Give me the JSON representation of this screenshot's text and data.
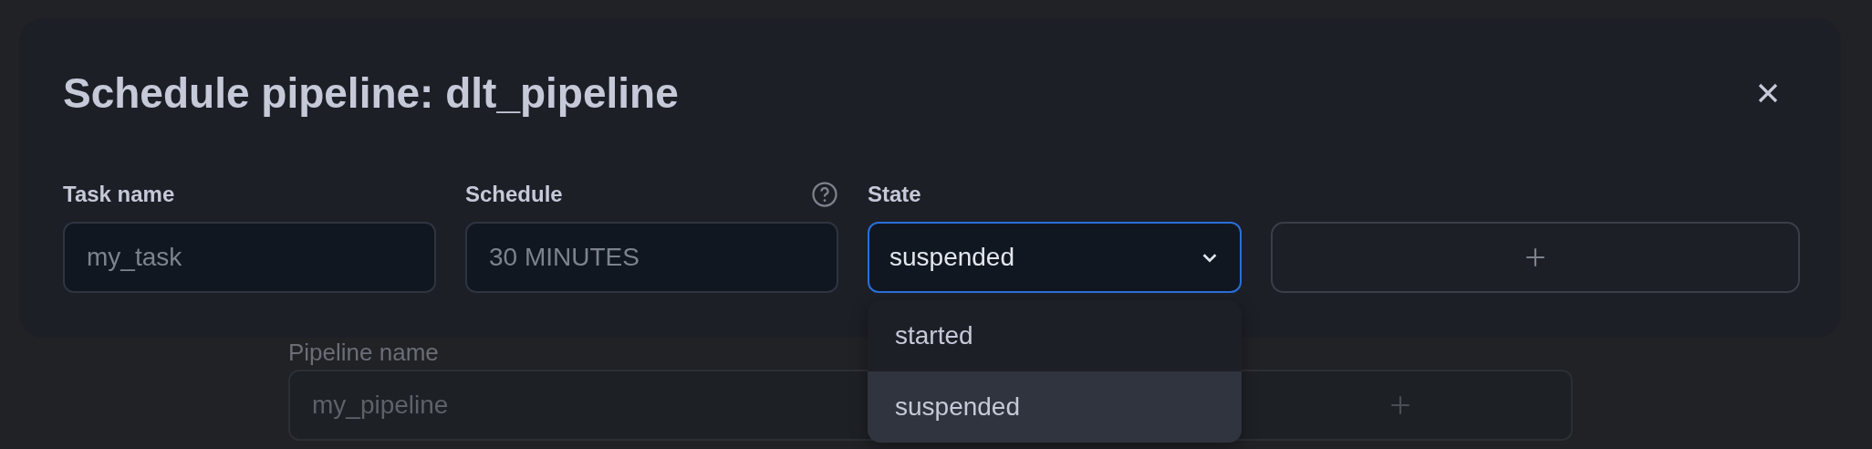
{
  "background_form": {
    "label": "Pipeline name",
    "field": {
      "placeholder": "my_pipeline"
    }
  },
  "dialog": {
    "title": "Schedule pipeline: dlt_pipeline",
    "fields": [
      {
        "kind": "text",
        "label": "Task name",
        "placeholder": "my_task",
        "help": false
      },
      {
        "kind": "text",
        "label": "Schedule",
        "placeholder": "30 MINUTES",
        "help": true
      },
      {
        "kind": "select",
        "label": "State",
        "help": false,
        "value": "suspended",
        "expanded": true,
        "options": [
          {
            "label": "started",
            "selected": false
          },
          {
            "label": "suspended",
            "selected": true
          }
        ]
      }
    ]
  }
}
